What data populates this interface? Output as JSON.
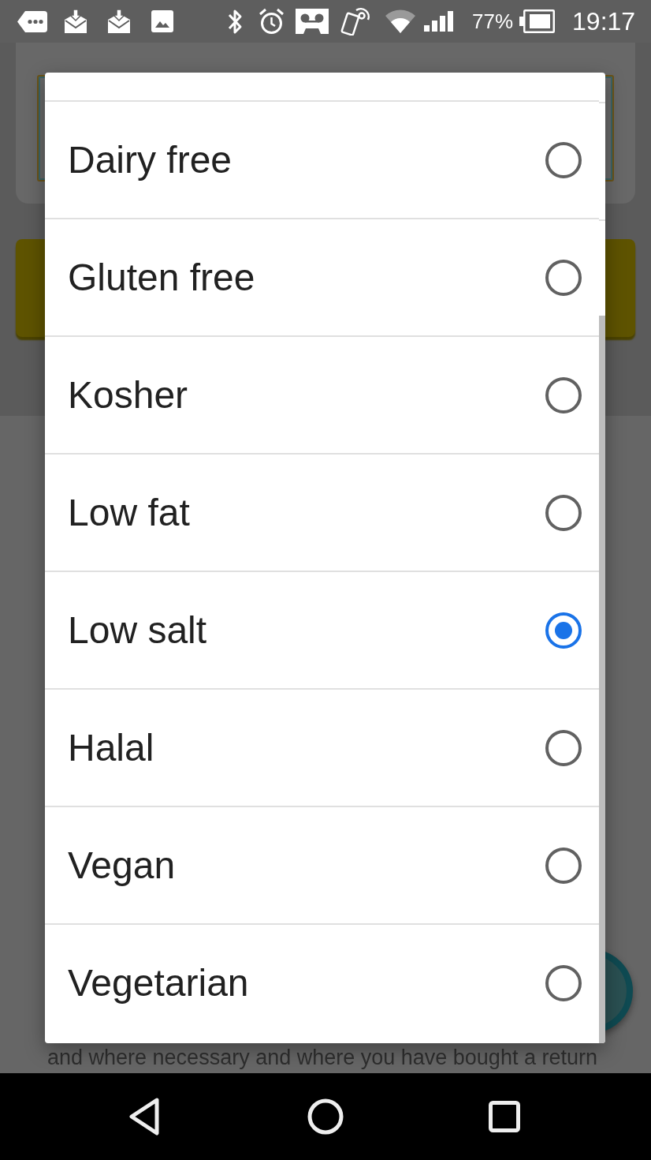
{
  "status_bar": {
    "battery": "77%",
    "time": "19:17"
  },
  "page": {
    "footer_text": "and where necessary and where you have bought a return"
  },
  "dialog": {
    "options": [
      {
        "label": "Dairy free",
        "selected": false
      },
      {
        "label": "Gluten free",
        "selected": false
      },
      {
        "label": "Kosher",
        "selected": false
      },
      {
        "label": "Low fat",
        "selected": false
      },
      {
        "label": "Low salt",
        "selected": true
      },
      {
        "label": "Halal",
        "selected": false
      },
      {
        "label": "Vegan",
        "selected": false
      },
      {
        "label": "Vegetarian",
        "selected": false
      }
    ]
  }
}
